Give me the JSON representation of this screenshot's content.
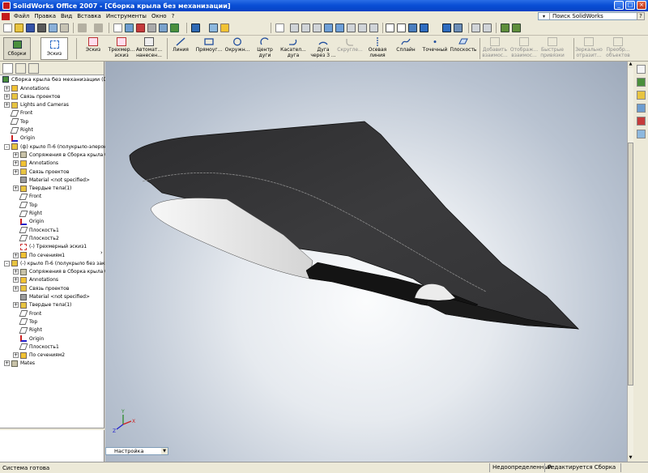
{
  "window": {
    "title": "SolidWorks Office 2007 - [Сборка крыла без механизации]",
    "controls": [
      "_",
      "□",
      "×"
    ]
  },
  "menu": {
    "items": [
      "Файл",
      "Правка",
      "Вид",
      "Вставка",
      "Инструменты",
      "Окно",
      "?"
    ],
    "search_placeholder": "Поиск SolidWorks",
    "search_help": "?"
  },
  "command_manager": {
    "tab_assembly": "Сборки",
    "tab_sketch": "Эскиз",
    "buttons": [
      {
        "label": "Эскиз",
        "enabled": true,
        "icon": "sketch-icon"
      },
      {
        "label": "Трехмер... эскиз",
        "enabled": true,
        "icon": "3d-sketch-icon"
      },
      {
        "label": "Автомат... нанесен...",
        "enabled": true,
        "icon": "smart-dimension-icon"
      },
      {
        "label": "Линия",
        "enabled": true,
        "icon": "line-icon"
      },
      {
        "label": "Прямоуг...",
        "enabled": true,
        "icon": "rectangle-icon"
      },
      {
        "label": "Окружн...",
        "enabled": true,
        "icon": "circle-icon"
      },
      {
        "label": "Центр дуги",
        "enabled": true,
        "icon": "center-arc-icon"
      },
      {
        "label": "Касател... дуга",
        "enabled": true,
        "icon": "tangent-arc-icon"
      },
      {
        "label": "Дуга через 3 ...",
        "enabled": true,
        "icon": "three-point-arc-icon"
      },
      {
        "label": "Скругле...",
        "enabled": false,
        "icon": "fillet-icon"
      },
      {
        "label": "Осевая линия",
        "enabled": true,
        "icon": "centerline-icon"
      },
      {
        "label": "Сплайн",
        "enabled": true,
        "icon": "spline-icon"
      },
      {
        "label": "Точечный",
        "enabled": true,
        "icon": "point-icon"
      },
      {
        "label": "Плоскость",
        "enabled": true,
        "icon": "plane-icon"
      },
      {
        "label": "Добавить взаимос...",
        "enabled": false,
        "icon": "add-relation-icon"
      },
      {
        "label": "Отображ... взаимос...",
        "enabled": false,
        "icon": "display-relations-icon"
      },
      {
        "label": "Быстрые привязки",
        "enabled": false,
        "icon": "quick-snaps-icon"
      },
      {
        "label": "Зеркально отразит...",
        "enabled": false,
        "icon": "mirror-icon"
      },
      {
        "label": "Преобр... объектов",
        "enabled": false,
        "icon": "convert-entities-icon"
      }
    ]
  },
  "tree": {
    "root": "Сборка крыла без механизации  (Defa",
    "items": [
      {
        "label": "Annotations",
        "level": 0,
        "exp": "+",
        "icon": "annotations-icon"
      },
      {
        "label": "Связь проектов",
        "level": 0,
        "exp": "+",
        "icon": "design-binder-icon"
      },
      {
        "label": "Lights and Cameras",
        "level": 0,
        "exp": "+",
        "icon": "lights-icon"
      },
      {
        "label": "Front",
        "level": 0,
        "exp": "",
        "icon": "plane-icon"
      },
      {
        "label": "Top",
        "level": 0,
        "exp": "",
        "icon": "plane-icon"
      },
      {
        "label": "Right",
        "level": 0,
        "exp": "",
        "icon": "plane-icon"
      },
      {
        "label": "Origin",
        "level": 0,
        "exp": "",
        "icon": "origin-icon"
      },
      {
        "label": "(ф) крыло П-6 (полукрыло-элерон",
        "level": 0,
        "exp": "-",
        "icon": "part-icon"
      },
      {
        "label": "Сопряжения в Сборка крыла б",
        "level": 1,
        "exp": "+",
        "icon": "mates-icon"
      },
      {
        "label": "Annotations",
        "level": 1,
        "exp": "+",
        "icon": "annotations-icon"
      },
      {
        "label": "Связь проектов",
        "level": 1,
        "exp": "+",
        "icon": "design-binder-icon"
      },
      {
        "label": "Material <not specified>",
        "level": 1,
        "exp": "",
        "icon": "material-icon"
      },
      {
        "label": "Твердые тела(1)",
        "level": 1,
        "exp": "+",
        "icon": "solid-bodies-icon"
      },
      {
        "label": "Front",
        "level": 1,
        "exp": "",
        "icon": "plane-icon"
      },
      {
        "label": "Top",
        "level": 1,
        "exp": "",
        "icon": "plane-icon"
      },
      {
        "label": "Right",
        "level": 1,
        "exp": "",
        "icon": "plane-icon"
      },
      {
        "label": "Origin",
        "level": 1,
        "exp": "",
        "icon": "origin-icon"
      },
      {
        "label": "Плоскость1",
        "level": 1,
        "exp": "",
        "icon": "plane-icon"
      },
      {
        "label": "Плоскость2",
        "level": 1,
        "exp": "",
        "icon": "plane-icon"
      },
      {
        "label": "(-) Трехмерный эскиз1",
        "level": 1,
        "exp": "",
        "icon": "3d-sketch-icon"
      },
      {
        "label": "По сечениям1",
        "level": 1,
        "exp": "+",
        "icon": "loft-icon"
      },
      {
        "label": "(-) крыло П-6 (полукрыло без закр",
        "level": 0,
        "exp": "-",
        "icon": "part-icon"
      },
      {
        "label": "Сопряжения в Сборка крыла б",
        "level": 1,
        "exp": "+",
        "icon": "mates-icon"
      },
      {
        "label": "Annotations",
        "level": 1,
        "exp": "+",
        "icon": "annotations-icon"
      },
      {
        "label": "Связь проектов",
        "level": 1,
        "exp": "+",
        "icon": "design-binder-icon"
      },
      {
        "label": "Material <not specified>",
        "level": 1,
        "exp": "",
        "icon": "material-icon"
      },
      {
        "label": "Твердые тела(1)",
        "level": 1,
        "exp": "+",
        "icon": "solid-bodies-icon"
      },
      {
        "label": "Front",
        "level": 1,
        "exp": "",
        "icon": "plane-icon"
      },
      {
        "label": "Top",
        "level": 1,
        "exp": "",
        "icon": "plane-icon"
      },
      {
        "label": "Right",
        "level": 1,
        "exp": "",
        "icon": "plane-icon"
      },
      {
        "label": "Origin",
        "level": 1,
        "exp": "",
        "icon": "origin-icon"
      },
      {
        "label": "Плоскость1",
        "level": 1,
        "exp": "",
        "icon": "plane-icon"
      },
      {
        "label": "По сечениям2",
        "level": 1,
        "exp": "+",
        "icon": "loft-icon"
      },
      {
        "label": "Mates",
        "level": 0,
        "exp": "+",
        "icon": "mates-icon"
      }
    ]
  },
  "viewport": {
    "configuration": "Настройка",
    "triad_labels": [
      "Y",
      "X",
      "Z"
    ]
  },
  "statusbar": {
    "left": "Система готова",
    "definition": "Недоопределенный",
    "mode": "Редактируется Сборка"
  },
  "colors": {
    "title_bar": "#0a4fd6",
    "chrome": "#ece9d8",
    "model_dark": "#3a3a3c",
    "model_light": "#ededed",
    "viewport_center": "#fbfcfd",
    "viewport_edge": "#9eaabb"
  }
}
